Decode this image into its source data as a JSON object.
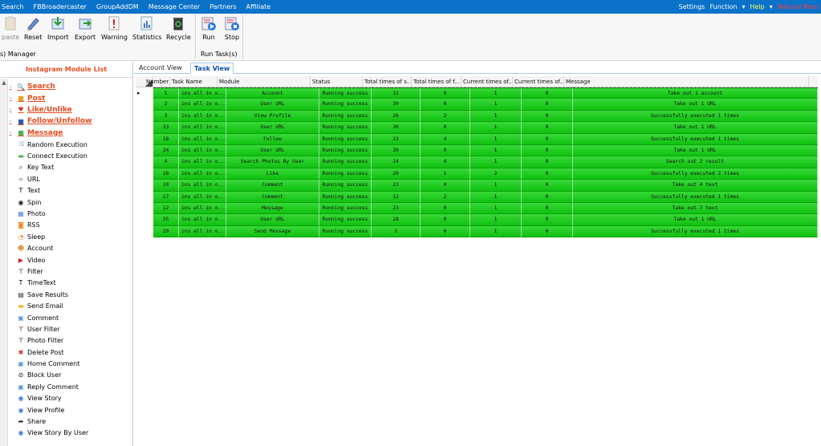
{
  "menu": {
    "items": [
      "Search",
      "FBBroadercaster",
      "GroupAddDM",
      "Message Center",
      "Partners",
      "Affiliate"
    ],
    "right": {
      "settings": "Settings",
      "function": "Function",
      "help": "Help",
      "register": "Natural Reso"
    }
  },
  "ribbon": {
    "buttons": [
      {
        "label": "paste",
        "icon": "paste-icon"
      },
      {
        "label": "Reset",
        "icon": "reset-icon"
      },
      {
        "label": "Import",
        "icon": "import-icon"
      },
      {
        "label": "Export",
        "icon": "export-icon"
      },
      {
        "label": "Warning",
        "icon": "warning-icon"
      },
      {
        "label": "Statistics",
        "icon": "statistics-icon"
      },
      {
        "label": "Recycle",
        "icon": "recycle-icon"
      }
    ],
    "group1_label": "s) Manager",
    "run_buttons": [
      {
        "label": "Run",
        "icon": "run-icon"
      },
      {
        "label": "Stop",
        "icon": "stop-icon"
      }
    ],
    "group2_label": "Run Task(s)"
  },
  "sidebar": {
    "title": "Instagram Module List",
    "items": [
      {
        "label": "Search",
        "type": "cat",
        "icon": "search-icon"
      },
      {
        "label": "Post",
        "type": "cat",
        "icon": "post-icon"
      },
      {
        "label": "Like/Unlike",
        "type": "cat",
        "icon": "heart-icon"
      },
      {
        "label": "Follow/Unfollow",
        "type": "cat",
        "icon": "follow-icon"
      },
      {
        "label": "Message",
        "type": "cat",
        "icon": "message-icon"
      },
      {
        "label": "Random Execution",
        "type": "item",
        "icon": "shuffle-icon"
      },
      {
        "label": "Connect Execution",
        "type": "item",
        "icon": "connect-icon"
      },
      {
        "label": "Key Text",
        "type": "item",
        "icon": "key-text-icon"
      },
      {
        "label": "URL",
        "type": "item",
        "icon": "url-icon"
      },
      {
        "label": "Text",
        "type": "item",
        "icon": "text-icon"
      },
      {
        "label": "Spin",
        "type": "item",
        "icon": "spin-icon"
      },
      {
        "label": "Photo",
        "type": "item",
        "icon": "photo-icon"
      },
      {
        "label": "RSS",
        "type": "item",
        "icon": "rss-icon"
      },
      {
        "label": "Sleep",
        "type": "item",
        "icon": "sleep-icon"
      },
      {
        "label": "Account",
        "type": "item",
        "icon": "account-icon"
      },
      {
        "label": "Video",
        "type": "item",
        "icon": "video-icon"
      },
      {
        "label": "Filter",
        "type": "item",
        "icon": "filter-icon"
      },
      {
        "label": "TimeText",
        "type": "item",
        "icon": "timetext-icon"
      },
      {
        "label": "Save Results",
        "type": "item",
        "icon": "save-icon"
      },
      {
        "label": "Send Email",
        "type": "item",
        "icon": "email-icon"
      },
      {
        "label": "Comment",
        "type": "item",
        "icon": "comment-icon"
      },
      {
        "label": "User Filter",
        "type": "item",
        "icon": "user-filter-icon"
      },
      {
        "label": "Photo Filter",
        "type": "item",
        "icon": "photo-filter-icon"
      },
      {
        "label": "Delete Post",
        "type": "item",
        "icon": "delete-icon"
      },
      {
        "label": "Home Comment",
        "type": "item",
        "icon": "home-comment-icon"
      },
      {
        "label": "Block User",
        "type": "item",
        "icon": "block-icon"
      },
      {
        "label": "Reply Comment",
        "type": "item",
        "icon": "reply-comment-icon"
      },
      {
        "label": "View Story",
        "type": "item",
        "icon": "view-story-icon"
      },
      {
        "label": "View Profile",
        "type": "item",
        "icon": "view-profile-icon"
      },
      {
        "label": "Share",
        "type": "item",
        "icon": "share-icon"
      },
      {
        "label": "View Story By User",
        "type": "item",
        "icon": "view-story-by-user-icon"
      }
    ]
  },
  "tabs": {
    "account_view": "Account View",
    "task_view": "Task View"
  },
  "table": {
    "columns": [
      "Number",
      "Task Name",
      "Module",
      "Status",
      "Total times of s...",
      "Total times of f...",
      "Current times of...",
      "Current times of...",
      "Message"
    ],
    "rows": [
      [
        "1",
        "ins all in o...",
        "Account",
        "Running success",
        "32",
        "0",
        "1",
        "0",
        "Take out 1 account"
      ],
      [
        "2",
        "ins all in o...",
        "User URL",
        "Running success",
        "30",
        "0",
        "1",
        "0",
        "Take out 1 URL"
      ],
      [
        "3",
        "ins all in o...",
        "View Profile",
        "Running success",
        "26",
        "2",
        "1",
        "0",
        "Successfully executed 1 times"
      ],
      [
        "33",
        "ins all in o...",
        "User URL",
        "Running success",
        "30",
        "0",
        "1",
        "0",
        "Take out 1 URL"
      ],
      [
        "18",
        "ins all in o...",
        "Follow",
        "Running success",
        "23",
        "4",
        "1",
        "0",
        "Successfully executed 1 times"
      ],
      [
        "34",
        "ins all in o...",
        "User URL",
        "Running success",
        "30",
        "0",
        "1",
        "0",
        "Take out 1 URL"
      ],
      [
        "4",
        "ins all in o...",
        "Search Photos By User",
        "Running success",
        "24",
        "4",
        "1",
        "0",
        "Search out 2 result"
      ],
      [
        "16",
        "ins all in o...",
        "Like",
        "Running success",
        "20",
        "1",
        "2",
        "0",
        "Successfully executed 2 times"
      ],
      [
        "10",
        "ins all in o...",
        "Comment",
        "Running success",
        "23",
        "0",
        "1",
        "0",
        "Take out 4 text"
      ],
      [
        "17",
        "ins all in o...",
        "Comment",
        "Running success",
        "12",
        "2",
        "1",
        "0",
        "Successfully executed 1 times"
      ],
      [
        "12",
        "ins all in o...",
        "Message",
        "Running success",
        "23",
        "0",
        "1",
        "0",
        "Take out 7 text"
      ],
      [
        "35",
        "ins all in o...",
        "User URL",
        "Running success",
        "28",
        "0",
        "1",
        "0",
        "Take out 1 URL"
      ],
      [
        "29",
        "ins all in o...",
        "Send Message",
        "Running success",
        "3",
        "0",
        "1",
        "0",
        "Successfully executed 1 times"
      ]
    ]
  }
}
